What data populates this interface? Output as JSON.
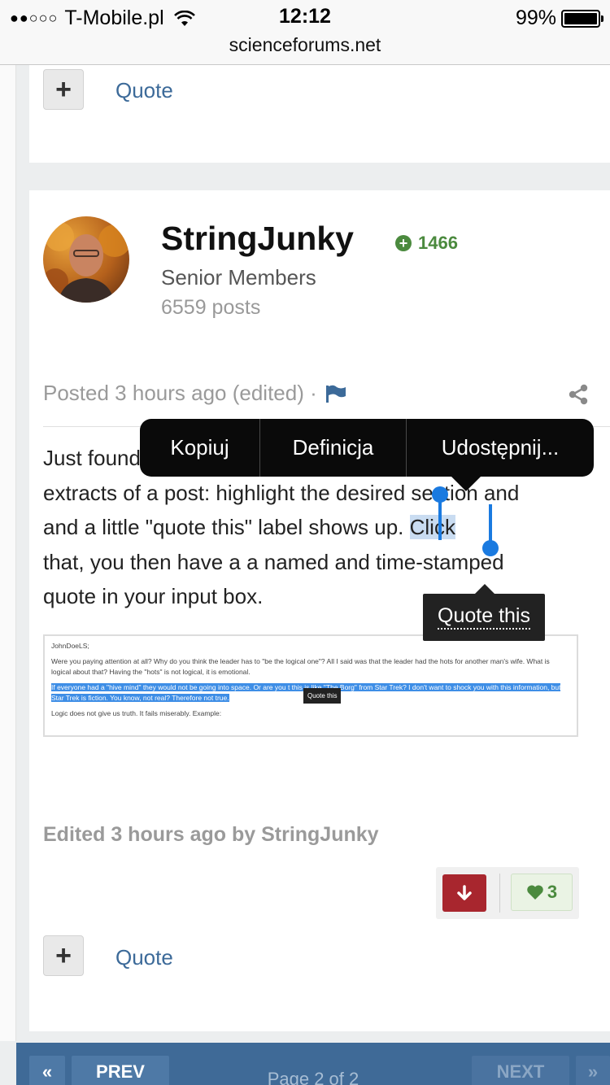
{
  "status_bar": {
    "signal": "●●○○○",
    "carrier": "T-Mobile.pl",
    "time": "12:12",
    "battery": "99%",
    "battery_level": 0.99,
    "url": "scienceforums.net"
  },
  "prev_post": {
    "add_label": "+",
    "quote_label": "Quote"
  },
  "post": {
    "author": "StringJunky",
    "reputation": "1466",
    "group": "Senior Members",
    "post_count": "6559 posts",
    "posted": "Posted 3 hours ago (edited) ·",
    "body_lines": [
      "Just found",
      "extracts of a post: highlight the desired section and",
      "and a little \"quote this\" label shows up. ",
      "that,  you then have a a named and time-stamped",
      "quote in your input box."
    ],
    "selected_word": "Click",
    "edited": "Edited 3 hours ago by StringJunky",
    "likes": "3",
    "downvote_icon": "arrow-down-icon",
    "add_label": "+",
    "quote_label": "Quote"
  },
  "ios_menu": {
    "items": [
      "Kopiuj",
      "Definicja",
      "Udostępnij..."
    ]
  },
  "quote_tooltip": "Quote this",
  "embedded_screenshot": {
    "line1": "JohnDoeLS;",
    "line2": "Were you paying attention at all? Why do you think the leader has to \"be the logical one\"? All I said was that the leader had the hots for another man's wife. What is logical about that? Having the \"hots\" is not logical, it is emotional.",
    "highlight": "If everyone had a \"hive mind\" they would not be going into space. Or are you t          this is like \"The Borg\" from Star Trek? I don't want to shock you with this information, but Star Trek is fiction. You know, not real? Therefore not true.",
    "tip": "Quote this",
    "line4": "Logic does not give us truth. It fails miserably. Example:"
  },
  "pagination": {
    "first": "«",
    "prev": "PREV",
    "page_info": "Page 2 of 2",
    "next": "NEXT",
    "last": "»"
  },
  "colors": {
    "link": "#3c6a99",
    "reputation": "#4b8a3e",
    "downvote": "#a8262e",
    "pager": "#3f6a97",
    "selection": "#1a7ae0"
  }
}
